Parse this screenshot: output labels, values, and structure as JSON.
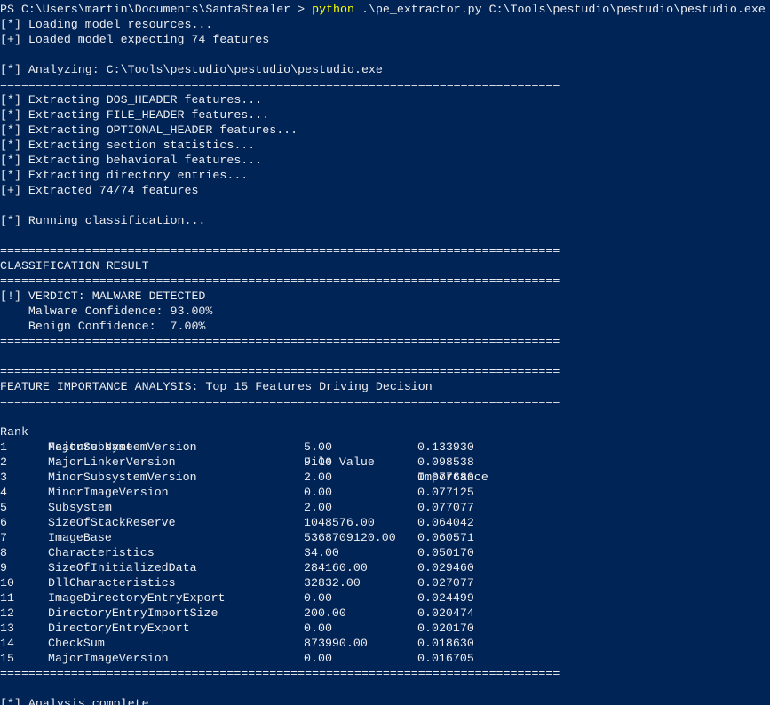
{
  "prompt": {
    "path": "PS C:\\Users\\martin\\Documents\\SantaStealer > ",
    "command": "python",
    "args": " .\\pe_extractor.py C:\\Tools\\pestudio\\pestudio\\pestudio.exe"
  },
  "separator": "===============================================================================",
  "dash_separator": "-------------------------------------------------------------------------------",
  "loading": [
    "[*] Loading model resources...",
    "[+] Loaded model expecting 74 features"
  ],
  "analyzing": "[*] Analyzing: C:\\Tools\\pestudio\\pestudio\\pestudio.exe",
  "extraction": [
    "[*] Extracting DOS_HEADER features...",
    "[*] Extracting FILE_HEADER features...",
    "[*] Extracting OPTIONAL_HEADER features...",
    "[*] Extracting section statistics...",
    "[*] Extracting behavioral features...",
    "[*] Extracting directory entries...",
    "[+] Extracted 74/74 features"
  ],
  "running": "[*] Running classification...",
  "classification": {
    "title": "CLASSIFICATION RESULT",
    "verdict": "[!] VERDICT: MALWARE DETECTED",
    "malware_conf": "    Malware Confidence: 93.00%",
    "benign_conf": "    Benign Confidence:  7.00%"
  },
  "features": {
    "title": "FEATURE IMPORTANCE ANALYSIS: Top 15 Features Driving Decision",
    "headers": {
      "rank": "Rank",
      "name": "Feature Name",
      "value": "File Value",
      "importance": "Importance"
    },
    "rows": [
      {
        "rank": "1",
        "name": "MajorSubsystemVersion",
        "value": "5.00",
        "importance": "0.133930"
      },
      {
        "rank": "2",
        "name": "MajorLinkerVersion",
        "value": "9.00",
        "importance": "0.098538"
      },
      {
        "rank": "3",
        "name": "MinorSubsystemVersion",
        "value": "2.00",
        "importance": "0.077680"
      },
      {
        "rank": "4",
        "name": "MinorImageVersion",
        "value": "0.00",
        "importance": "0.077125"
      },
      {
        "rank": "5",
        "name": "Subsystem",
        "value": "2.00",
        "importance": "0.077077"
      },
      {
        "rank": "6",
        "name": "SizeOfStackReserve",
        "value": "1048576.00",
        "importance": "0.064042"
      },
      {
        "rank": "7",
        "name": "ImageBase",
        "value": "5368709120.00",
        "importance": "0.060571"
      },
      {
        "rank": "8",
        "name": "Characteristics",
        "value": "34.00",
        "importance": "0.050170"
      },
      {
        "rank": "9",
        "name": "SizeOfInitializedData",
        "value": "284160.00",
        "importance": "0.029460"
      },
      {
        "rank": "10",
        "name": "DllCharacteristics",
        "value": "32832.00",
        "importance": "0.027077"
      },
      {
        "rank": "11",
        "name": "ImageDirectoryEntryExport",
        "value": "0.00",
        "importance": "0.024499"
      },
      {
        "rank": "12",
        "name": "DirectoryEntryImportSize",
        "value": "200.00",
        "importance": "0.020474"
      },
      {
        "rank": "13",
        "name": "DirectoryEntryExport",
        "value": "0.00",
        "importance": "0.020170"
      },
      {
        "rank": "14",
        "name": "CheckSum",
        "value": "873990.00",
        "importance": "0.018630"
      },
      {
        "rank": "15",
        "name": "MajorImageVersion",
        "value": "0.00",
        "importance": "0.016705"
      }
    ]
  },
  "complete": "[*] Analysis complete."
}
